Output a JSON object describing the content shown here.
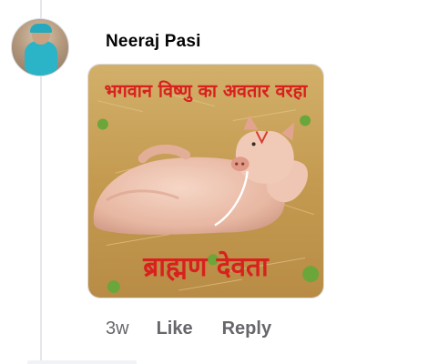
{
  "comment": {
    "author": "Neeraj Pasi",
    "image_caption_top": "भगवान विष्णु का अवतार वरहा",
    "image_caption_bottom": "ब्राह्मण देवता",
    "timestamp": "3w",
    "like_label": "Like",
    "reply_label": "Reply"
  },
  "colors": {
    "meta_text": "#65676b",
    "author_text": "#050505",
    "caption_red": "#d8211e"
  },
  "icons": {
    "avatar": "user-photo-avatar"
  }
}
